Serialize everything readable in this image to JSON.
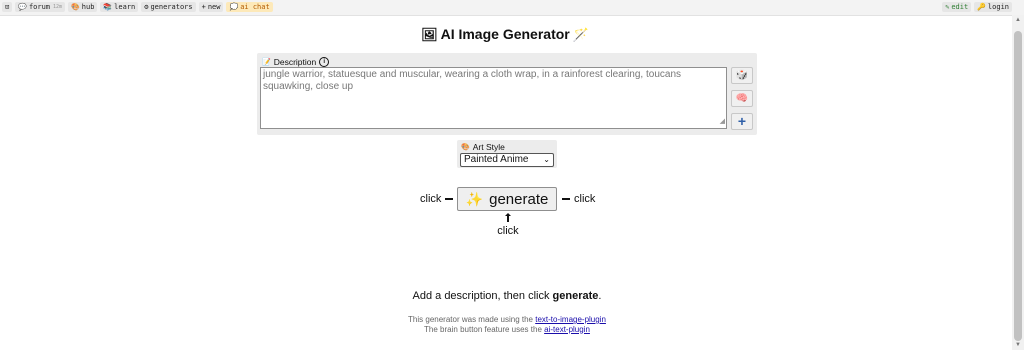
{
  "nav": {
    "left": [
      {
        "icon": "⊡",
        "label": ""
      },
      {
        "icon": "💬",
        "label": "forum",
        "count": "12m"
      },
      {
        "icon": "🎨",
        "label": "hub"
      },
      {
        "icon": "📚",
        "label": "learn"
      },
      {
        "icon": "⚙",
        "label": "generators"
      },
      {
        "icon": "+",
        "label": "new"
      },
      {
        "icon": "💭",
        "label": "ai chat"
      }
    ],
    "right": [
      {
        "icon": "✎",
        "label": "edit"
      },
      {
        "icon": "🔑",
        "label": "login"
      }
    ]
  },
  "header": {
    "title": "AI Image Generator"
  },
  "description": {
    "label": "Description",
    "value": "jungle warrior, statuesque and muscular, wearing a cloth wrap, in a rainforest clearing, toucans squawking, close up"
  },
  "art_style": {
    "label": "Art Style",
    "selected": "Painted Anime"
  },
  "generate": {
    "label": "generate",
    "hint_click": "click"
  },
  "hint": {
    "prefix": "Add a description, then click ",
    "bold": "generate",
    "suffix": "."
  },
  "footer": {
    "line1_prefix": "This generator was made using the ",
    "line1_link": "text-to-image-plugin",
    "line2_prefix": "The brain button feature uses the ",
    "line2_link": "ai-text-plugin"
  }
}
